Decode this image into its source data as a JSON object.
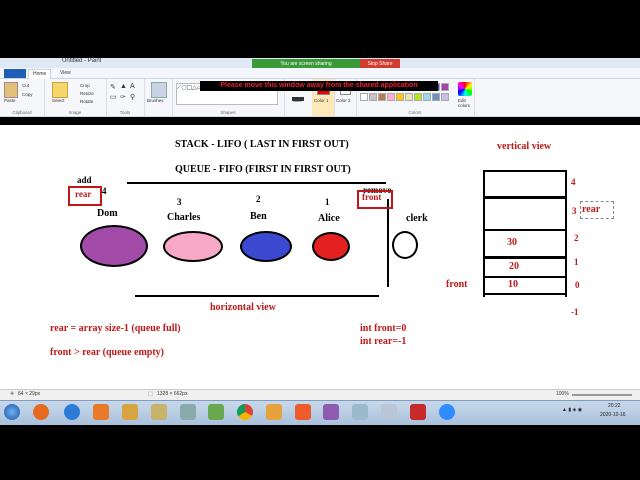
{
  "window": {
    "title": "Untitled - Paint"
  },
  "screen_share": {
    "status_text": "You are screen sharing",
    "stop_label": "Stop Share",
    "warning": "Please move this window away from the shared application"
  },
  "tabs": {
    "home": "Home",
    "view": "View"
  },
  "ribbon": {
    "clipboard": {
      "label": "Clipboard",
      "paste": "Paste",
      "cut": "Cut",
      "copy": "Copy"
    },
    "image": {
      "label": "Image",
      "select": "Select",
      "crop": "Crop",
      "resize": "Resize",
      "rotate": "Rotate"
    },
    "tools": {
      "label": "Tools"
    },
    "brushes": {
      "label": "Brushes"
    },
    "shapes": {
      "label": "Shapes"
    },
    "size": {
      "label": "Size"
    },
    "color1": {
      "label": "Color 1"
    },
    "color2": {
      "label": "Color 2"
    },
    "colors": {
      "label": "Colors",
      "edit": "Edit colors"
    }
  },
  "canvas": {
    "stack_title": "STACK - LIFO ( LAST IN FIRST OUT)",
    "queue_title": "QUEUE - FIFO (FIRST IN FIRST OUT)",
    "add": "add",
    "rear": "rear",
    "remove": "remove",
    "front": "front",
    "clerk": "clerk",
    "people": [
      {
        "index": "4",
        "name": "Dom",
        "color": "#a24aa8"
      },
      {
        "index": "3",
        "name": "Charles",
        "color": "#f7a9c7"
      },
      {
        "index": "2",
        "name": "Ben",
        "color": "#3a49d0"
      },
      {
        "index": "1",
        "name": "Alice",
        "color": "#e42020"
      }
    ],
    "horizontal_view": "horizontal view",
    "vertical_view": "vertical view",
    "rear_full": "rear = array size-1  (queue full)",
    "front_rear": "front > rear    (queue empty)",
    "int_front": "int front=0",
    "int_rear": "int rear=-1",
    "vertical": {
      "indices": [
        "4",
        "3",
        "2",
        "1",
        "0",
        "-1"
      ],
      "cells": [
        "",
        "",
        "30",
        "20",
        "10"
      ],
      "front_label": "front",
      "rear_label": "rear"
    }
  },
  "statusbar": {
    "pos": "64 × 29px",
    "size": "1328 × 662px",
    "zoom": "100%"
  },
  "taskbar": {
    "time": "20:22",
    "date": "2020-10-16"
  }
}
